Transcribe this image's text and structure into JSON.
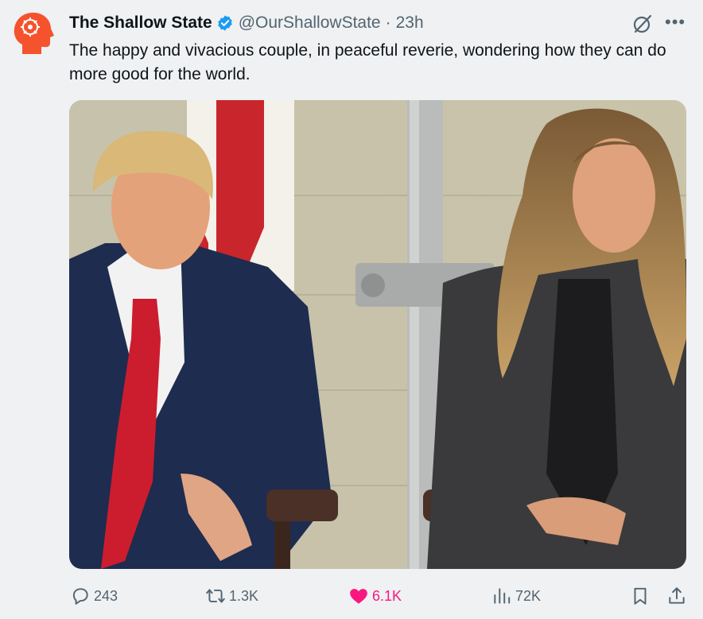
{
  "post": {
    "author_name": "The Shallow State",
    "handle": "@OurShallowState",
    "separator": "·",
    "time": "23h",
    "text": "The happy and vivacious couple, in peaceful reverie, wondering how they can do more good for the world."
  },
  "actions": {
    "replies": "243",
    "reposts": "1.3K",
    "likes": "6.1K",
    "views": "72K"
  },
  "icons": {
    "avatar": "shallow-state-logo",
    "verified": "verified-badge-icon",
    "grok": "grok-icon",
    "more": "more-icon",
    "reply": "reply-icon",
    "repost": "repost-icon",
    "like": "heart-icon",
    "views": "views-icon",
    "bookmark": "bookmark-icon",
    "share": "share-icon"
  },
  "colors": {
    "accent": "#1d9bf0",
    "like": "#f91880",
    "muted": "#536471",
    "avatar": "#f4532d"
  }
}
